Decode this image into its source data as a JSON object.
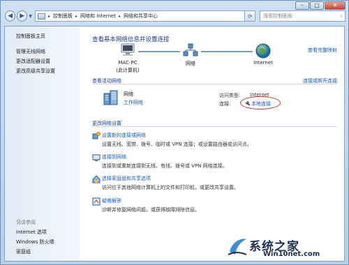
{
  "address": {
    "crumbs": [
      "控制面板",
      "网络和 Internet",
      "网络和共享中心"
    ],
    "search_placeholder": "搜索控制面板"
  },
  "sidebar": {
    "home": "控制面板主页",
    "items": [
      "管理无线网络",
      "更改适配器设置",
      "更改高级共享设置"
    ],
    "see_also": "另请参阅",
    "see_also_items": [
      "Internet 选项",
      "Windows 防火墙",
      "家庭组"
    ]
  },
  "main": {
    "title": "查看基本网络信息并设置连接",
    "full_map": "查看完整映射",
    "map": {
      "computer": "MAC-PC",
      "computer_sub": "(此计算机)",
      "network": "网络",
      "internet": "Internet"
    },
    "active": {
      "heading": "查看活动网络",
      "connect_link": "连接或断开连接",
      "name": "网络",
      "type": "工作网络",
      "access_label": "访问类型:",
      "access_value": "Internet",
      "conn_label": "连接:",
      "conn_value": "本地连接"
    },
    "change": {
      "heading": "更改网络设置",
      "tasks": [
        {
          "title": "设置新的连接或网络",
          "desc": "设置无线、宽带、拨号、临时或 VPN 连接；或设置路由器或访问点。"
        },
        {
          "title": "连接到网络",
          "desc": "连接到或重新连接到无线、有线、拨号或 VPN 网络连接。"
        },
        {
          "title": "选择家庭组和共享选项",
          "desc": "访问位于其他网络计算机上的文件和打印机，或更改共享设置。"
        },
        {
          "title": "疑难解答",
          "desc": "诊断并修复网络问题，或获得故障排除信息。"
        }
      ]
    }
  },
  "watermark": {
    "text": "系统之家",
    "url": "Win10net.com"
  },
  "colors": {
    "link": "#1759b7",
    "title": "#1a3d8c",
    "annotation": "#c0392b"
  }
}
